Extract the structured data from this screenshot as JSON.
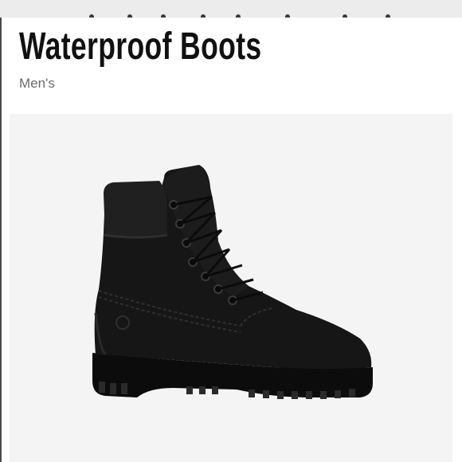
{
  "product": {
    "title": "Waterproof Boots",
    "subtitle": "Men's",
    "image_icon": "black-nubuck-boot-image"
  },
  "colors": {
    "page_background": "#ffffff",
    "title": "#111111",
    "subtitle": "#6b6b6b",
    "image_background": "#f4f4f4",
    "boot": "#141414"
  }
}
